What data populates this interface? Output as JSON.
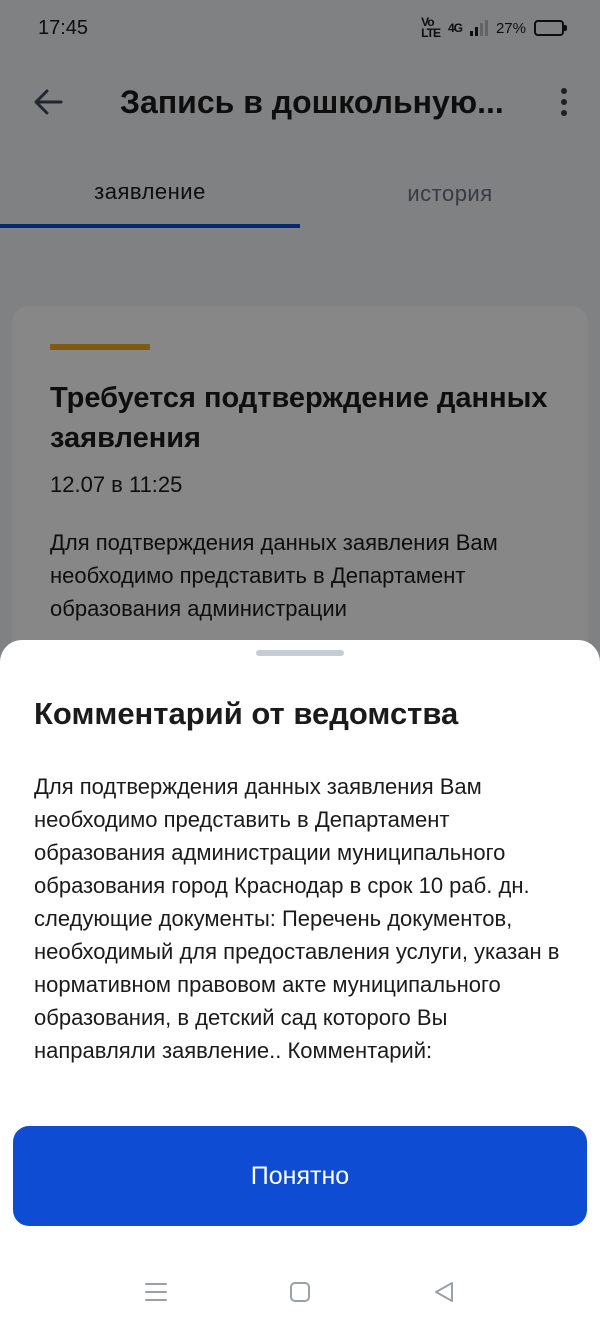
{
  "status_bar": {
    "time": "17:45",
    "network_label": "Vo LTE",
    "network_type": "4G",
    "battery_text": "27%",
    "battery_level": 0.27
  },
  "header": {
    "title": "Запись в дошкольную...",
    "back_icon": "arrow-left-icon",
    "more_icon": "more-vertical-icon"
  },
  "tabs": [
    {
      "label": "заявление",
      "active": true
    },
    {
      "label": "история",
      "active": false
    }
  ],
  "status_card": {
    "title": "Требуется подтверждение данных заявления",
    "date": "12.07 в 11:25",
    "text": "Для подтверждения данных заявления Вам необходимо представить в Департамент образования администрации",
    "stripe_color": "#f0ad1f"
  },
  "sheet": {
    "title": "Комментарий от ведомства",
    "body": "Для подтверждения данных заявления Вам необходимо представить в Департамент образования администрации муниципального образования город Краснодар в срок 10 раб. дн. следующие документы: Перечень документов, необходимый для предоставления услуги, указан в нормативном правовом акте муниципального образования, в детский сад которого Вы направляли заявление.. Комментарий:",
    "button_label": "Понятно"
  },
  "nav_bar": {
    "recents_icon": "menu-lines-icon",
    "home_icon": "square-home-icon",
    "back_icon": "triangle-back-icon"
  },
  "colors": {
    "accent": "#0d4cd3",
    "warning": "#f0ad1f",
    "scrim": "rgba(0,0,0,0.47)"
  }
}
